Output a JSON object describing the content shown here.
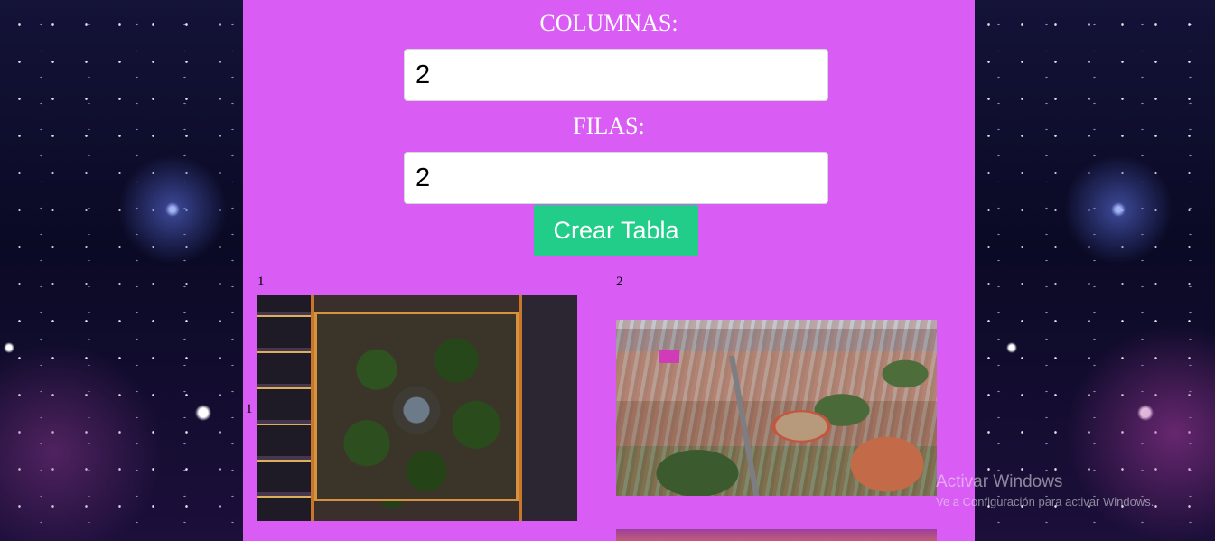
{
  "form": {
    "columns_label": "COLUMNAS:",
    "columns_value": "2",
    "rows_label": "FILAS:",
    "rows_value": "2",
    "create_button_label": "Crear Tabla"
  },
  "table": {
    "column_headers": [
      "1",
      "2"
    ],
    "row_headers": [
      "1"
    ]
  },
  "watermark": {
    "title": "Activar Windows",
    "subtitle": "Ve a Configuración para activar Windows."
  },
  "colors": {
    "panel": "#d95cf4",
    "button": "#22cd8a",
    "label_text": "#ffffff"
  }
}
